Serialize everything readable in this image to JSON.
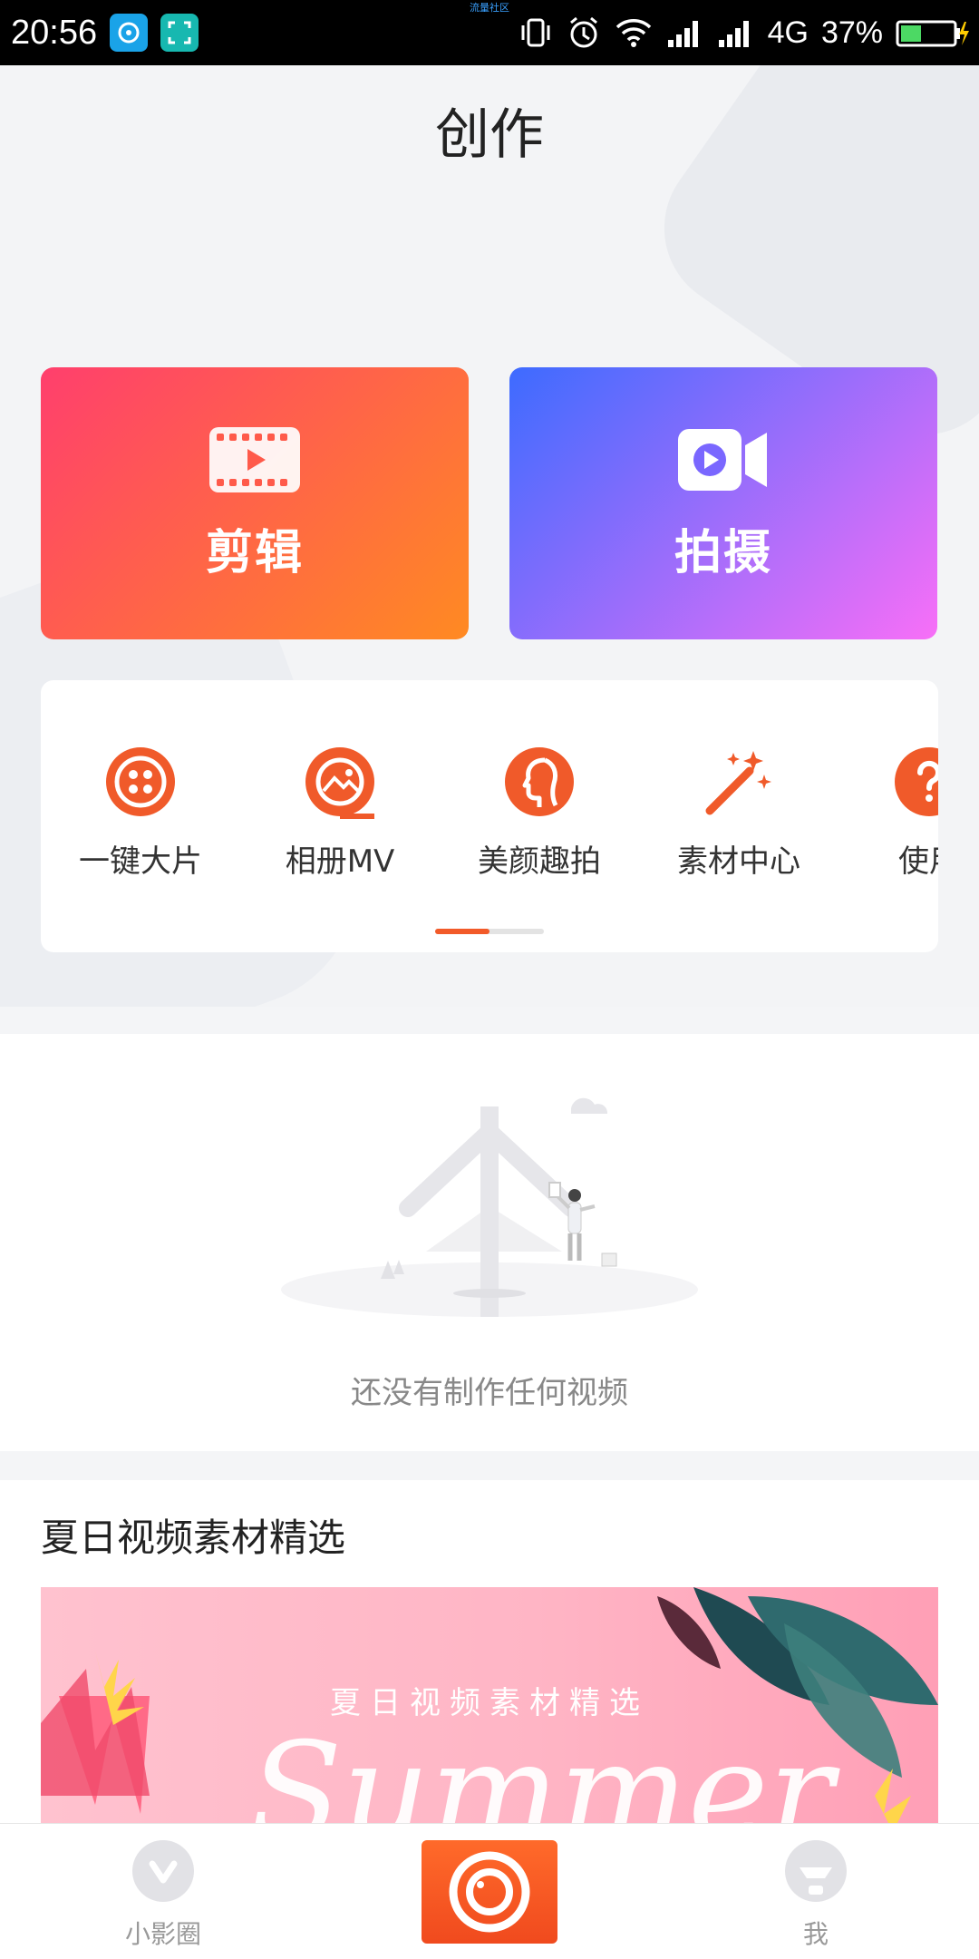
{
  "status_bar": {
    "time": "20:56",
    "center_text": "流量社区",
    "network": "4G",
    "battery": "37%",
    "icons": [
      "vibrate-icon",
      "alarm-icon",
      "wifi-icon",
      "signal-icon",
      "signal-icon",
      "battery-icon"
    ]
  },
  "header": {
    "title": "创作"
  },
  "main_actions": [
    {
      "label": "剪辑",
      "icon": "film-icon"
    },
    {
      "label": "拍摄",
      "icon": "video-camera-icon"
    }
  ],
  "tools": [
    {
      "label": "一键大片",
      "icon": "film-reel-icon"
    },
    {
      "label": "相册MV",
      "icon": "album-icon"
    },
    {
      "label": "美颜趣拍",
      "icon": "face-profile-icon"
    },
    {
      "label": "素材中心",
      "icon": "magic-wand-icon"
    },
    {
      "label": "使用",
      "icon": "help-icon"
    }
  ],
  "tools_pager": {
    "pages": 2,
    "current": 1
  },
  "empty_state": {
    "text": "还没有制作任何视频"
  },
  "featured": {
    "title": "夏日视频素材精选",
    "banner_subtitle": "夏日视频素材精选",
    "banner_script": "Summer"
  },
  "tabbar": {
    "left_label": "小影圈",
    "right_label": "我",
    "accent": "#f25a29"
  }
}
